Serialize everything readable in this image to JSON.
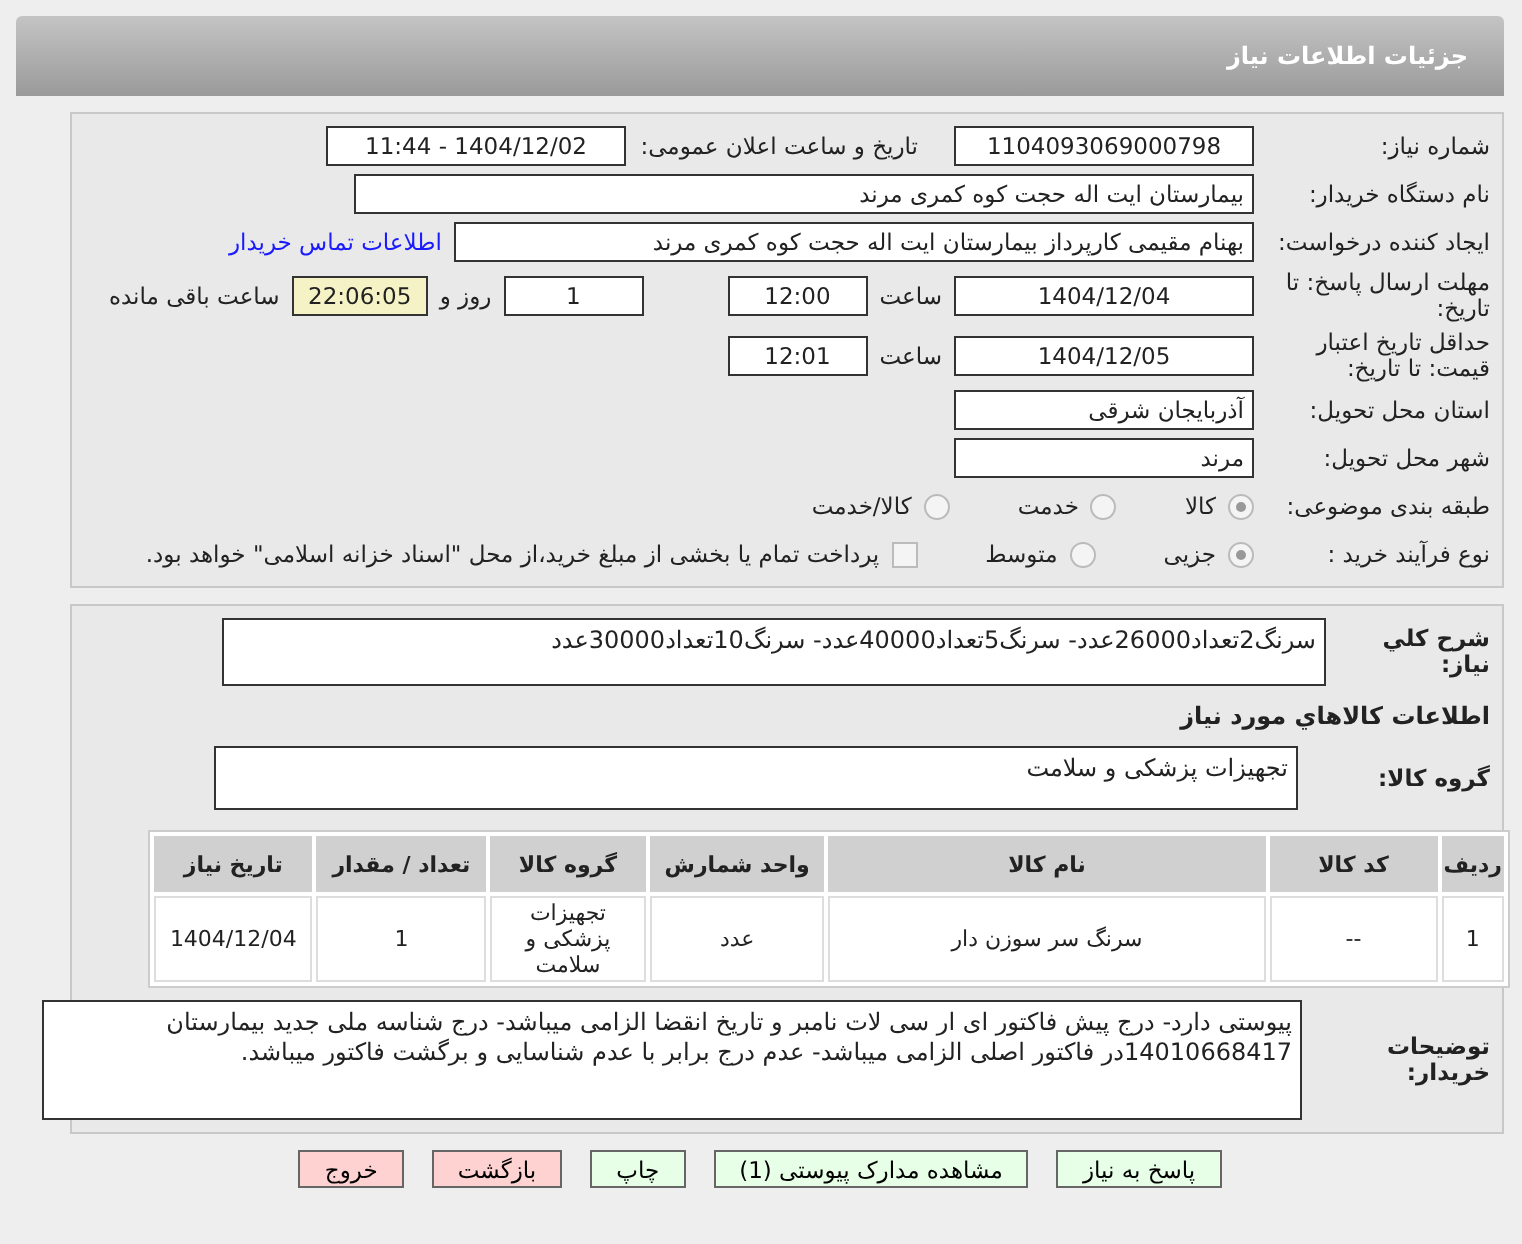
{
  "header": {
    "title": "جزئیات اطلاعات نیاز"
  },
  "need_info": {
    "need_number": {
      "label": "شماره نیاز:",
      "value": "1104093069000798"
    },
    "announce": {
      "label": "تاریخ و ساعت اعلان عمومی:",
      "value": "1404/12/02 - 11:44"
    },
    "buyer": {
      "label": "نام دستگاه خریدار:",
      "value": "بیمارستان ایت اله حجت کوه کمری مرند"
    },
    "creator": {
      "label": "ایجاد کننده درخواست:",
      "value": "بهنام مقیمی کارپرداز بیمارستان ایت اله حجت کوه کمری مرند",
      "link": "اطلاعات تماس خریدار"
    },
    "deadline": {
      "label": "مهلت ارسال پاسخ: تا تاریخ:",
      "date": "1404/12/04",
      "time_label": "ساعت",
      "time": "12:00",
      "days": "1",
      "days_label": "روز و",
      "remaining": "22:06:05",
      "remaining_label": "ساعت باقی مانده"
    },
    "validity": {
      "label": "حداقل تاریخ اعتبار قیمت: تا تاریخ:",
      "date": "1404/12/05",
      "time_label": "ساعت",
      "time": "12:01"
    },
    "province": {
      "label": "استان محل تحویل:",
      "value": "آذربایجان شرقی"
    },
    "city": {
      "label": "شهر محل تحویل:",
      "value": "مرند"
    },
    "category": {
      "label": "طبقه بندی موضوعی:",
      "options": [
        {
          "label": "کالا",
          "selected": true
        },
        {
          "label": "خدمت",
          "selected": false
        },
        {
          "label": "کالا/خدمت",
          "selected": false
        }
      ]
    },
    "process": {
      "label": "نوع فرآیند خرید :",
      "options": [
        {
          "label": "جزیی",
          "selected": true
        },
        {
          "label": "متوسط",
          "selected": false
        }
      ],
      "payment": {
        "label": "پرداخت تمام یا بخشی از مبلغ خرید،از محل \"اسناد خزانه اسلامی\" خواهد بود.",
        "checked": false
      }
    }
  },
  "goods": {
    "summary": {
      "label": "شرح کلي نياز:",
      "value": "سرنگ2تعداد26000عدد- سرنگ5تعداد40000عدد- سرنگ10تعداد30000عدد"
    },
    "heading": "اطلاعات کالاهاي مورد نياز",
    "group": {
      "label": "گروه کالا:",
      "value": "تجهیزات پزشکی و سلامت"
    },
    "table": {
      "columns": [
        "ردیف",
        "کد کالا",
        "نام کالا",
        "واحد شمارش",
        "گروه کالا",
        "تعداد / مقدار",
        "تاریخ نیاز"
      ],
      "rows": [
        [
          "1",
          "--",
          "سرنگ سر سوزن دار",
          "عدد",
          "تجهیزات پزشکی و سلامت",
          "1",
          "1404/12/04"
        ]
      ]
    },
    "notes": {
      "label": "توضیحات خریدار:",
      "value": "پیوستی دارد- درج پیش فاکتور ای ار سی لات نامبر و تاریخ انقضا الزامی میباشد- درج شناسه ملی  جدید بیمارستان 14010668417در فاکتور اصلی الزامی میباشد- عدم درج برابر با عدم شناسایی و برگشت فاکتور میباشد."
    }
  },
  "buttons": [
    {
      "label": "پاسخ به نیاز",
      "kind": "normal"
    },
    {
      "label": "مشاهده مدارک پیوستی (1)",
      "kind": "normal"
    },
    {
      "label": "چاپ",
      "kind": "normal"
    },
    {
      "label": "بازگشت",
      "kind": "danger"
    },
    {
      "label": "خروج",
      "kind": "danger"
    }
  ]
}
